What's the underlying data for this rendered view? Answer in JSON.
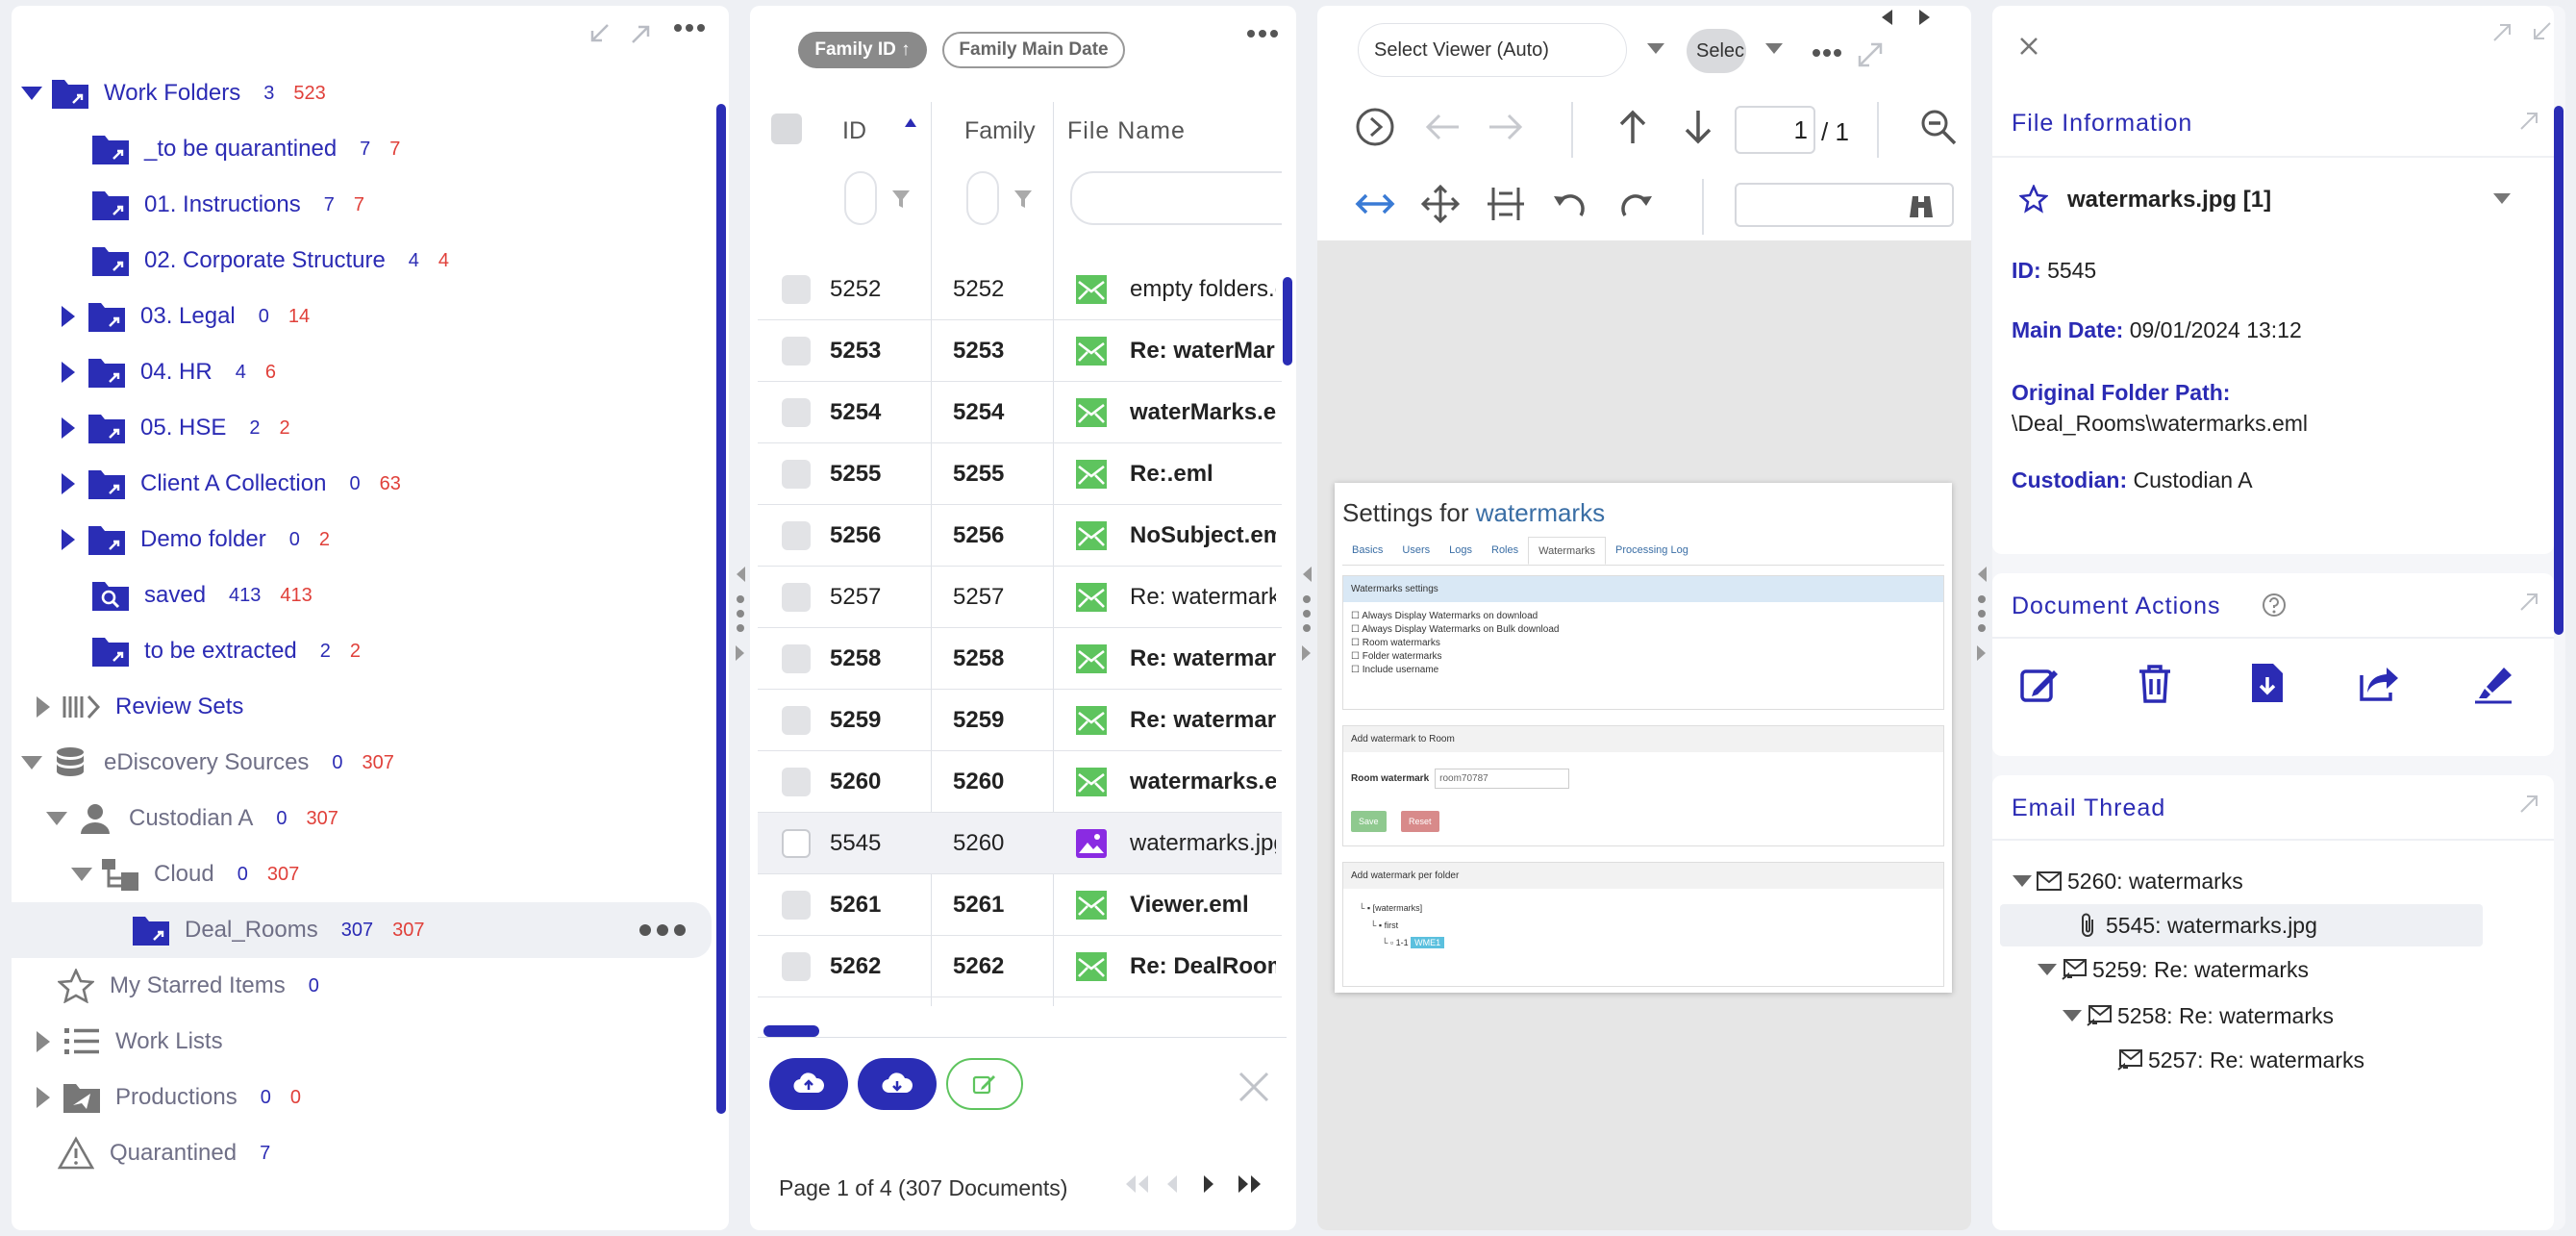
{
  "left": {
    "tree": [
      {
        "key": "work-folders",
        "label": "Work Folders",
        "count1": "3",
        "count2": "523",
        "grey": false
      },
      {
        "key": "to-be-quarantined",
        "label": "_to be quarantined",
        "count1": "7",
        "count2": "7",
        "grey": false
      },
      {
        "key": "instructions",
        "label": "01. Instructions",
        "count1": "7",
        "count2": "7",
        "grey": false
      },
      {
        "key": "corporate-structure",
        "label": "02. Corporate Structure",
        "count1": "4",
        "count2": "4",
        "grey": false
      },
      {
        "key": "legal",
        "label": "03. Legal",
        "count1": "0",
        "count2": "14",
        "grey": false
      },
      {
        "key": "hr",
        "label": "04. HR",
        "count1": "4",
        "count2": "6",
        "grey": false
      },
      {
        "key": "hse",
        "label": "05. HSE",
        "count1": "2",
        "count2": "2",
        "grey": false
      },
      {
        "key": "client-a-collection",
        "label": "Client A Collection",
        "count1": "0",
        "count2": "63",
        "grey": false
      },
      {
        "key": "demo-folder",
        "label": "Demo folder",
        "count1": "0",
        "count2": "2",
        "grey": false
      },
      {
        "key": "saved",
        "label": "saved",
        "count1": "413",
        "count2": "413",
        "grey": false
      },
      {
        "key": "to-be-extracted",
        "label": "to be extracted",
        "count1": "2",
        "count2": "2",
        "grey": false
      },
      {
        "key": "review-sets",
        "label": "Review Sets",
        "count1": "",
        "count2": "",
        "grey": false
      },
      {
        "key": "ediscovery-sources",
        "label": "eDiscovery Sources",
        "count1": "0",
        "count2": "307",
        "grey": true
      },
      {
        "key": "custodian-a",
        "label": "Custodian A",
        "count1": "0",
        "count2": "307",
        "grey": true
      },
      {
        "key": "cloud",
        "label": "Cloud",
        "count1": "0",
        "count2": "307",
        "grey": true
      },
      {
        "key": "deal-rooms",
        "label": "Deal_Rooms",
        "count1": "307",
        "count2": "307",
        "grey": true
      },
      {
        "key": "my-starred-items",
        "label": "My Starred Items",
        "count1": "0",
        "count2": "",
        "grey": true
      },
      {
        "key": "work-lists",
        "label": "Work Lists",
        "count1": "",
        "count2": "",
        "grey": true
      },
      {
        "key": "productions",
        "label": "Productions",
        "count1": "0",
        "count2": "0",
        "grey": true
      },
      {
        "key": "quarantined",
        "label": "Quarantined",
        "count1": "7",
        "count2": "",
        "grey": true
      }
    ]
  },
  "mid": {
    "sort_pills": [
      "Family ID ↑",
      "Family Main Date"
    ],
    "columns": {
      "id": "ID",
      "family": "Family",
      "file_name": "File Name"
    },
    "rows": [
      {
        "id": "5252",
        "family": "5252",
        "name": "empty folders.eml",
        "bold": false,
        "type": "email"
      },
      {
        "id": "5253",
        "family": "5253",
        "name": "Re: waterMarks.eml",
        "bold": true,
        "type": "email"
      },
      {
        "id": "5254",
        "family": "5254",
        "name": "waterMarks.eml",
        "bold": true,
        "type": "email"
      },
      {
        "id": "5255",
        "family": "5255",
        "name": "Re:.eml",
        "bold": true,
        "type": "email"
      },
      {
        "id": "5256",
        "family": "5256",
        "name": "NoSubject.eml",
        "bold": true,
        "type": "email"
      },
      {
        "id": "5257",
        "family": "5257",
        "name": "Re: watermarks.eml",
        "bold": false,
        "type": "email"
      },
      {
        "id": "5258",
        "family": "5258",
        "name": "Re: watermarks.eml",
        "bold": true,
        "type": "email"
      },
      {
        "id": "5259",
        "family": "5259",
        "name": "Re: watermarks.eml",
        "bold": true,
        "type": "email"
      },
      {
        "id": "5260",
        "family": "5260",
        "name": "watermarks.eml",
        "bold": true,
        "type": "email"
      },
      {
        "id": "5545",
        "family": "5260",
        "name": "watermarks.jpg",
        "bold": false,
        "type": "image",
        "selected": true
      },
      {
        "id": "5261",
        "family": "5261",
        "name": "Viewer.eml",
        "bold": true,
        "type": "email"
      },
      {
        "id": "5262",
        "family": "5262",
        "name": "Re: DealRooms.eml",
        "bold": true,
        "type": "email"
      }
    ],
    "pagination": "Page 1 of 4 (307 Documents)"
  },
  "viewer": {
    "select_viewer": "Select Viewer (Auto)",
    "select_short": "Selec",
    "page_current": "1",
    "page_total": "/ 1",
    "doc": {
      "title_prefix": "Settings for ",
      "title_link": "watermarks",
      "tabs": [
        "Basics",
        "Users",
        "Logs",
        "Roles",
        "Watermarks",
        "Processing Log"
      ],
      "section1": "Watermarks settings",
      "options": [
        "Always Display Watermarks on download",
        "Always Display Watermarks on Bulk download",
        "Room watermarks",
        "Folder watermarks",
        "Include username"
      ],
      "section2": "Add watermark to Room",
      "room_label": "Room watermark",
      "room_value": "room70787",
      "save": "Save",
      "reset": "Reset",
      "section3": "Add watermark per folder",
      "tree1": "[watermarks]",
      "tree2": "first",
      "tree3": "1-1",
      "tag": "WME1"
    }
  },
  "right": {
    "file_info_title": "File Information",
    "file_name": "watermarks.jpg [1]",
    "id_label": "ID:",
    "id_value": "5545",
    "date_label": "Main Date:",
    "date_value": "09/01/2024 13:12",
    "path_label": "Original Folder Path:",
    "path_value": "\\Deal_Rooms\\watermarks.eml",
    "custodian_label": "Custodian:",
    "custodian_value": "Custodian A",
    "doc_actions_title": "Document Actions",
    "email_thread_title": "Email Thread",
    "thread": [
      "5260: watermarks",
      "5545: watermarks.jpg",
      "5259: Re: watermarks",
      "5258: Re: watermarks",
      "5257: Re: watermarks"
    ]
  },
  "colors": {
    "accent": "#2b2bb4",
    "count_red": "#e0403a",
    "email_green": "#5ec45e",
    "image_purple": "#8a2be2"
  }
}
